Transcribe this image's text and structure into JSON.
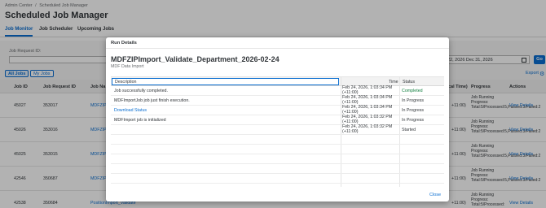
{
  "breadcrumb": {
    "items": [
      "Admin Center",
      "Scheduled Job Manager"
    ],
    "separator": "/"
  },
  "page_title": "Scheduled Job Manager",
  "tabs": [
    {
      "label": "Job Monitor",
      "active": true
    },
    {
      "label": "Job Scheduler",
      "active": false
    },
    {
      "label": "Upcoming Jobs",
      "active": false
    }
  ],
  "filters": {
    "job_request_id_label": "Job Request ID:",
    "date_range_value": "22, 2026 Dec 31, 2026",
    "go_label": "Go"
  },
  "segment_buttons": [
    {
      "label": "All Jobs",
      "active": true
    },
    {
      "label": "My Jobs",
      "active": false
    }
  ],
  "export_label": "Export",
  "table": {
    "headers": [
      "Job ID",
      "Job Request ID",
      "Job Na",
      "cal Time)",
      "Progress",
      "Actions"
    ],
    "rows": [
      {
        "job_id": "45027",
        "request_id": "353017",
        "name": "MDFZIP",
        "time": "+11:00)",
        "progress": "Job Running Progress: Total:5/Processed:5,Passed:3/Failed:2",
        "action": "View Details"
      },
      {
        "job_id": "45026",
        "request_id": "353016",
        "name": "MDFZIP",
        "time": "+11:00)",
        "progress": "Job Running Progress: Total:5/Processed:5,Passed:3/Failed:2",
        "action": "View Details"
      },
      {
        "job_id": "45025",
        "request_id": "353015",
        "name": "MDFZIP",
        "time": "+11:00)",
        "progress": "Job Running Progress: Total:5/Processed:5,Passed:3/Failed:2",
        "action": "View Details"
      },
      {
        "job_id": "42546",
        "request_id": "350687",
        "name": "MDFZIP",
        "time": "+11:00)",
        "progress": "Job Running Progress: Total:5/Processed:5,Passed:3/Failed:2",
        "action": "View Details"
      },
      {
        "job_id": "42538",
        "request_id": "350684",
        "name": "PositionImport_Validate",
        "time": "+11:00)",
        "progress": "Job Running Progress: Total:5/Processed:",
        "action": "View Details"
      }
    ]
  },
  "dialog": {
    "header": "Run Details",
    "title": "MDFZIPImport_Validate_Department_2026-02-24",
    "subtitle": "MDF Data Import",
    "columns": {
      "description": "Description",
      "time": "Time",
      "status": "Status"
    },
    "rows": [
      {
        "description": "Job successfully completed.",
        "time": "Feb 24, 2026, 1:03:34 PM (+11:00)",
        "status": "Completed",
        "link": false,
        "status_color": "#107e3e"
      },
      {
        "description": "MDFImportJob job just finish execution.",
        "time": "Feb 24, 2026, 1:03:34 PM (+11:00)",
        "status": "In Progress",
        "link": false,
        "status_color": "#32363a"
      },
      {
        "description": "Download Status",
        "time": "Feb 24, 2026, 1:03:34 PM (+11:00)",
        "status": "In Progress",
        "link": true,
        "status_color": "#32363a"
      },
      {
        "description": "MDFImport job is initialized",
        "time": "Feb 24, 2026, 1:03:32 PM (+11:00)",
        "status": "In Progress",
        "link": false,
        "status_color": "#32363a"
      },
      {
        "description": "",
        "time": "Feb 24, 2026, 1:03:32 PM (+11:00)",
        "status": "Started",
        "link": false,
        "status_color": "#32363a"
      }
    ],
    "close_label": "Close"
  },
  "colors": {
    "accent": "#0a6ed1",
    "completed": "#107e3e",
    "overlay": "rgba(0,0,0,0.30)"
  },
  "icons": {
    "calendar": "calendar-icon",
    "settings": "settings-icon"
  }
}
